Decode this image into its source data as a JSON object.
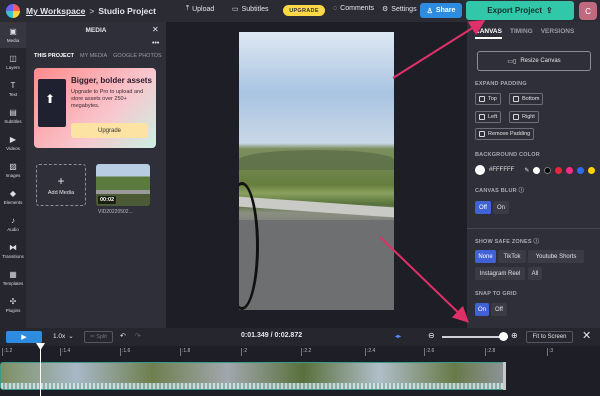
{
  "topbar": {
    "workspace": "My Workspace",
    "separator": ">",
    "project": "Studio Project",
    "upload_label": "Upload",
    "subtitles_label": "Subtitles",
    "upgrade_label": "UPGRADE",
    "comments_label": "Comments",
    "settings_label": "Settings",
    "share_label": "Share",
    "export_label": "Export Project",
    "avatar_letter": "C"
  },
  "sidebar": {
    "items": [
      {
        "icon": "media-icon",
        "label": "Media"
      },
      {
        "icon": "layers-icon",
        "label": "Layers"
      },
      {
        "icon": "text-icon",
        "label": "Text"
      },
      {
        "icon": "subtitles-icon",
        "label": "Subtitles"
      },
      {
        "icon": "videos-icon",
        "label": "Videos"
      },
      {
        "icon": "images-icon",
        "label": "Images"
      },
      {
        "icon": "elements-icon",
        "label": "Elements"
      },
      {
        "icon": "audio-icon",
        "label": "Audio"
      },
      {
        "icon": "transitions-icon",
        "label": "Transitions"
      },
      {
        "icon": "templates-icon",
        "label": "Templates"
      },
      {
        "icon": "plugins-icon",
        "label": "Plugins"
      }
    ]
  },
  "media_panel": {
    "title": "MEDIA",
    "tabs": [
      "THIS PROJECT",
      "MY MEDIA",
      "GOOGLE PHOTOS"
    ],
    "promo": {
      "heading": "Bigger, bolder assets",
      "body": "Upgrade to Pro to upload and store assets over 250+ megabytes.",
      "button": "Upgrade"
    },
    "add_media_label": "Add Media",
    "clip": {
      "duration": "00:02",
      "name": "VID20220502..."
    }
  },
  "settings": {
    "tabs": [
      "CANVAS",
      "TIMING",
      "VERSIONS"
    ],
    "resize_label": "Resize Canvas",
    "expand_padding_title": "EXPAND PADDING",
    "padding_options": [
      "Top",
      "Bottom",
      "Left",
      "Right",
      "Remove Padding"
    ],
    "background_color_title": "BACKGROUND COLOR",
    "background_hex": "#FFFFFF",
    "palette": [
      "#ffffff",
      "#000000",
      "#e8263a",
      "#ff2d87",
      "#2d6df0",
      "#ffd200"
    ],
    "canvas_blur_title": "CANVAS BLUR",
    "canvas_blur_options": [
      "Off",
      "On"
    ],
    "safe_zones_title": "SHOW SAFE ZONES",
    "safe_zone_options": [
      "None",
      "TikTok",
      "Youtube Shorts",
      "Instagram Reel",
      "All"
    ],
    "snap_title": "SNAP TO GRID",
    "snap_options": [
      "On",
      "Off"
    ]
  },
  "playbar": {
    "speed": "1.0x",
    "split_label": "Split",
    "timecode": "0:01.349 / 0:02.872",
    "fit_label": "Fit to Screen",
    "zoom_level": 0.87
  },
  "timeline": {
    "ticks": [
      ":1.2",
      ":1.4",
      ":1.6",
      ":1.8",
      ":2",
      ":2.2",
      ":2.4",
      ":2.6",
      ":2.8",
      ":3"
    ]
  }
}
